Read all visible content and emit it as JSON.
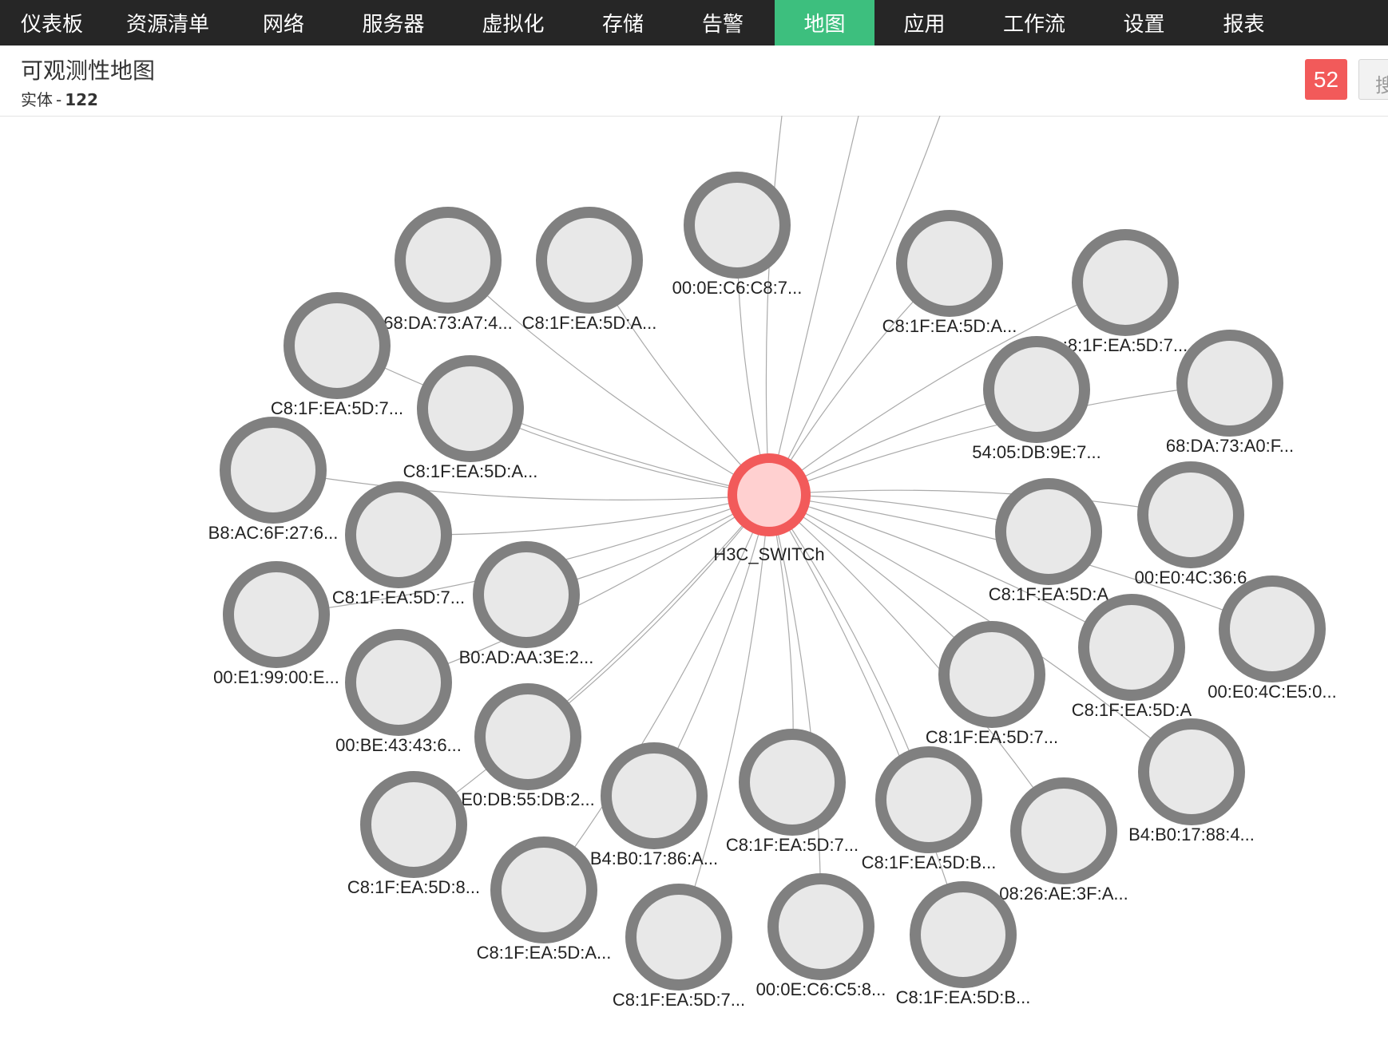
{
  "nav": {
    "items": [
      {
        "label": "仪表板",
        "active": false
      },
      {
        "label": "资源清单",
        "active": false
      },
      {
        "label": "网络",
        "active": false
      },
      {
        "label": "服务器",
        "active": false
      },
      {
        "label": "虚拟化",
        "active": false
      },
      {
        "label": "存储",
        "active": false
      },
      {
        "label": "告警",
        "active": false
      },
      {
        "label": "地图",
        "active": true
      },
      {
        "label": "应用",
        "active": false
      },
      {
        "label": "工作流",
        "active": false
      },
      {
        "label": "设置",
        "active": false
      },
      {
        "label": "报表",
        "active": false
      }
    ],
    "active_color": "#3dbf7e"
  },
  "header": {
    "title": "可观测性地图",
    "entity_label": "实体",
    "entity_separator": "-",
    "entity_count": "122",
    "alarm_count": "52",
    "search_button_partial": "搜"
  },
  "map": {
    "center": {
      "label": "H3C_SWITCh",
      "color": "#f25a5a"
    },
    "nodes": [
      "68:DA:73:A7:4...",
      "C8:1F:EA:5D:A...",
      "00:0E:C6:C8:7...",
      "C8:1F:EA:5D:A...",
      ":8:1F:EA:5D:7...",
      "C8:1F:EA:5D:7...",
      "C8:1F:EA:5D:A...",
      "54:05:DB:9E:7...",
      "68:DA:73:A0:F...",
      "B8:AC:6F:27:6...",
      "C8:1F:EA:5D:7...",
      "C8:1F:EA:5D:A",
      "00:E0:4C:36:6",
      "00:E1:99:00:E...",
      "B0:AD:AA:3E:2...",
      "C8:1F:EA:5D:A",
      "00:E0:4C:E5:0...",
      "00:BE:43:43:6...",
      "C8:1F:EA:5D:7...",
      "E0:DB:55:DB:2...",
      "B4:B0:17:88:4...",
      "C8:1F:EA:5D:8...",
      "B4:B0:17:86:A...",
      "C8:1F:EA:5D:7...",
      "C8:1F:EA:5D:B...",
      "08:26:AE:3F:A...",
      "C8:1F:EA:5D:A...",
      "C8:1F:EA:5D:7...",
      "00:0E:C6:C5:8...",
      "C8:1F:EA:5D:B..."
    ]
  }
}
